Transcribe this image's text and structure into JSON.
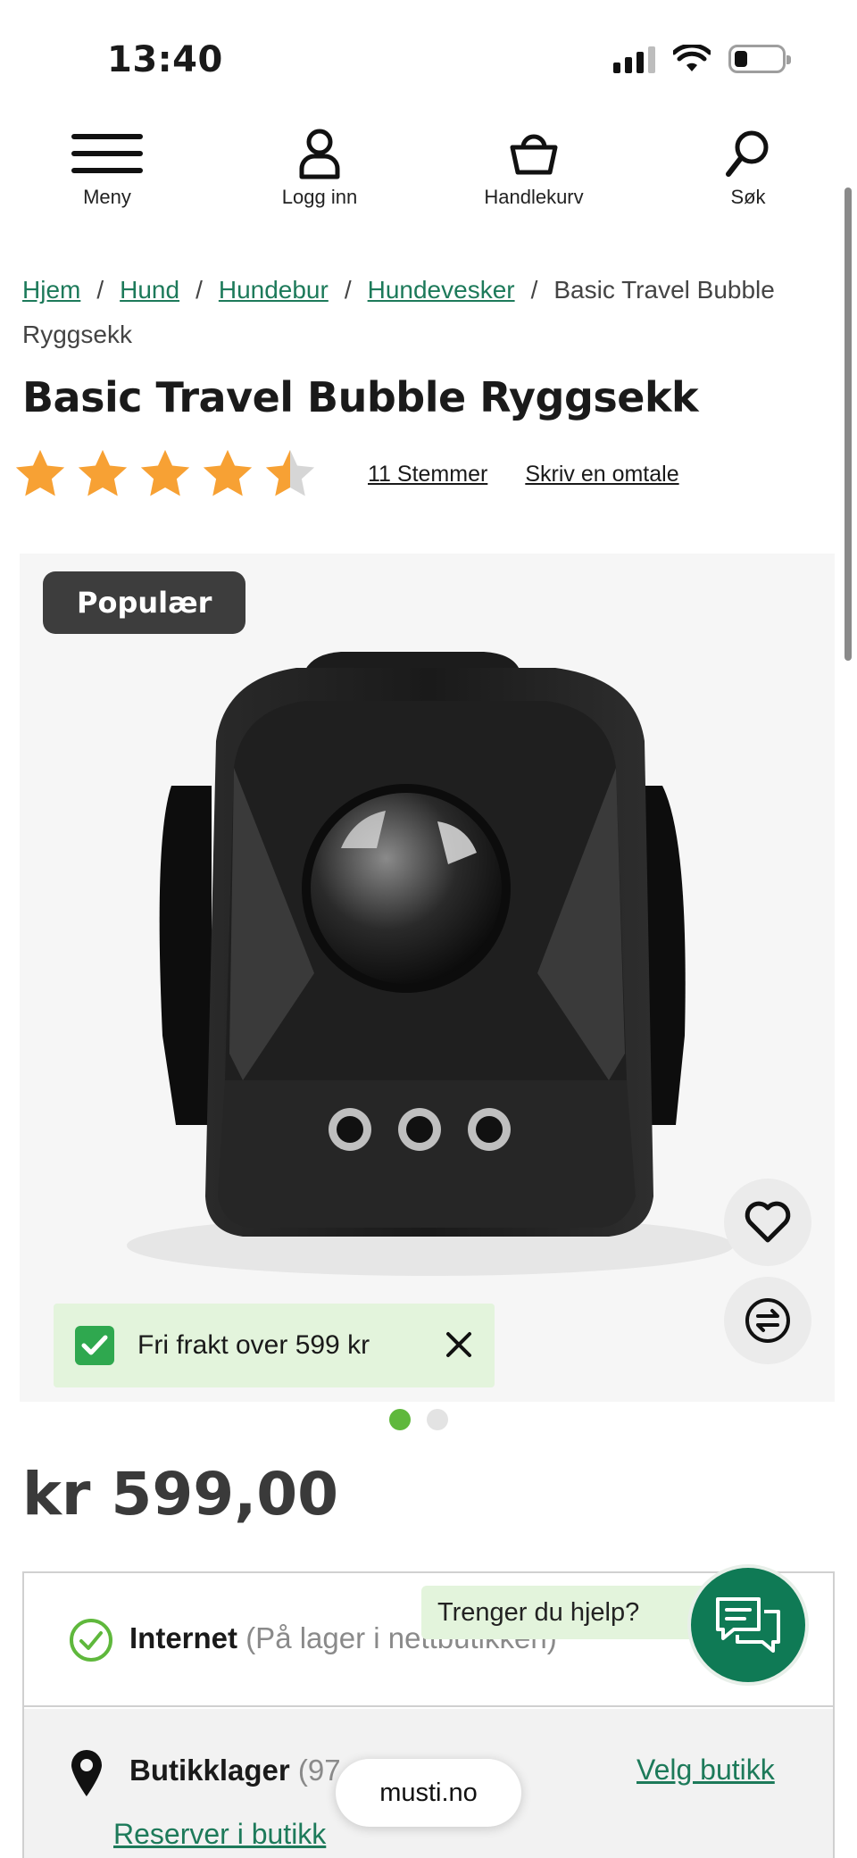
{
  "status_bar": {
    "time": "13:40"
  },
  "nav": {
    "menu_label": "Meny",
    "login_label": "Logg inn",
    "cart_label": "Handlekurv",
    "search_label": "Søk"
  },
  "breadcrumb": {
    "items": [
      "Hjem",
      "Hund",
      "Hundebur",
      "Hundevesker"
    ],
    "separator": "/",
    "current": "Basic Travel Bubble Ryggsekk"
  },
  "product": {
    "title": "Basic Travel Bubble Ryggsekk",
    "rating": 4.5,
    "rating_max": 5,
    "votes_label": "11 Stemmer",
    "write_review_label": "Skriv en omtale",
    "badge": "Populær",
    "price": "kr 599,00",
    "gallery_count": 2,
    "gallery_active": 1
  },
  "toast": {
    "text": "Fri frakt over 599 kr"
  },
  "stock": {
    "internet_label": "Internet",
    "internet_status": "(På lager i nettbutikken)",
    "store_label": "Butikklager",
    "store_count": "(97",
    "choose_store_label": "Velg butikk",
    "reserve_label": "Reserver i butikk"
  },
  "help": {
    "text": "Trenger du hjelp?"
  },
  "browser": {
    "url": "musti.no"
  },
  "colors": {
    "accent_green": "#1d7a5a",
    "star": "#f7a134",
    "badge_bg": "#3d3d3d",
    "toast_bg": "#e3f4dc",
    "chat_green": "#0f7a55"
  },
  "icons": [
    "menu-icon",
    "user-icon",
    "basket-icon",
    "search-icon",
    "heart-icon",
    "compare-icon",
    "check-icon",
    "close-icon",
    "location-pin-icon",
    "chat-icon"
  ]
}
